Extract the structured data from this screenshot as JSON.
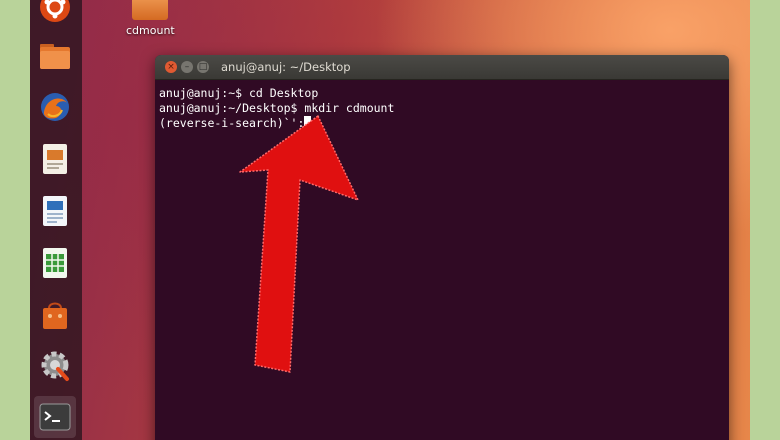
{
  "desktop": {
    "icon_label": "cdmount"
  },
  "launcher": {
    "items": [
      {
        "icon": "ubuntu-dash-icon"
      },
      {
        "icon": "files-folder-icon"
      },
      {
        "icon": "firefox-icon"
      },
      {
        "icon": "impress-presentation-icon"
      },
      {
        "icon": "writer-document-icon"
      },
      {
        "icon": "calc-spreadsheet-icon"
      },
      {
        "icon": "software-center-icon"
      },
      {
        "icon": "settings-gear-icon"
      },
      {
        "icon": "terminal-icon"
      }
    ]
  },
  "terminal": {
    "title": "anuj@anuj: ~/Desktop",
    "lines": [
      "anuj@anuj:~$ cd Desktop",
      "anuj@anuj:~/Desktop$ mkdir cdmount",
      "(reverse-i-search)`':"
    ]
  },
  "colors": {
    "terminal_bg": "#300a24",
    "arrow": "#e01010",
    "close_button": "#e05a32"
  }
}
